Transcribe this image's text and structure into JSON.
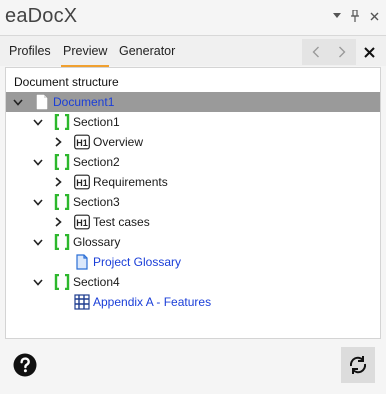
{
  "app": {
    "title": "eaDocX"
  },
  "window_controls": {
    "dropdown_icon": "chevron-down-icon",
    "pin_icon": "pin-icon",
    "close_icon": "close-icon"
  },
  "tabs": [
    {
      "label": "Profiles",
      "active": false
    },
    {
      "label": "Preview",
      "active": true
    },
    {
      "label": "Generator",
      "active": false
    }
  ],
  "nav": {
    "back_icon": "chevron-left-icon",
    "forward_icon": "chevron-right-icon",
    "close_icon": "close-icon"
  },
  "panel": {
    "label": "Document structure",
    "tree": [
      {
        "label": "Document1",
        "icon": "document-icon",
        "expander": "expanded",
        "selected": true,
        "link": true
      },
      {
        "label": "Section1",
        "icon": "section-icon",
        "expander": "expanded"
      },
      {
        "label": "Overview",
        "icon": "heading1-icon",
        "expander": "collapsed"
      },
      {
        "label": "Section2",
        "icon": "section-icon",
        "expander": "expanded"
      },
      {
        "label": "Requirements",
        "icon": "heading1-icon",
        "expander": "collapsed"
      },
      {
        "label": "Section3",
        "icon": "section-icon",
        "expander": "expanded"
      },
      {
        "label": "Test cases",
        "icon": "heading1-icon",
        "expander": "collapsed"
      },
      {
        "label": "Glossary",
        "icon": "section-icon",
        "expander": "expanded"
      },
      {
        "label": "Project Glossary",
        "icon": "glossary-document-icon",
        "expander": "none",
        "link": true
      },
      {
        "label": "Section4",
        "icon": "section-icon",
        "expander": "expanded"
      },
      {
        "label": "Appendix A - Features",
        "icon": "table-icon",
        "expander": "none",
        "link": true
      }
    ],
    "icon_text": {
      "heading1": "H1"
    }
  },
  "footer": {
    "help_icon": "help-icon",
    "refresh_icon": "refresh-icon"
  },
  "colors": {
    "accent_tab": "#f0a030",
    "section_bracket": "#2db82d",
    "link": "#1a3ed8",
    "selected_row": "#9a9a9a"
  }
}
